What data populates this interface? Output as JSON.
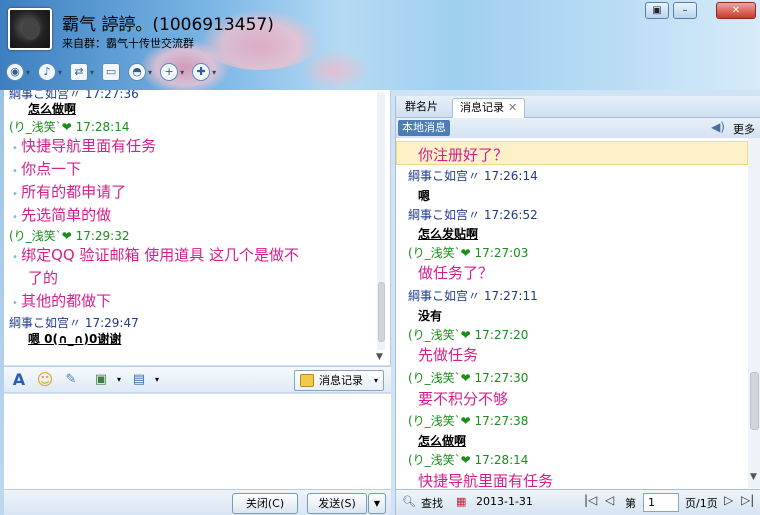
{
  "header": {
    "group_name": "霸气 諪諪。(1006913457)",
    "from_group": "来自群：霸气十传世交流群",
    "window_controls": [
      "▣",
      "–",
      "✕"
    ]
  },
  "toolbar": {
    "icons": [
      "video-icon",
      "voice-icon",
      "file-transfer-icon",
      "remote-icon",
      "share-icon",
      "add-member-icon",
      "app-icon"
    ]
  },
  "chat": {
    "messages": [
      {
        "kind": "sender-blue",
        "text": "綱事こ如宫〃   17:27:36"
      },
      {
        "kind": "bold-u",
        "text": "怎么做啊"
      },
      {
        "kind": "sender-green",
        "name": "(り_浅笑`",
        "time": "17:28:14"
      },
      {
        "kind": "pink",
        "text": "快捷导航里面有任务"
      },
      {
        "kind": "pink",
        "text": "你点一下"
      },
      {
        "kind": "pink",
        "text": "所有的都申请了"
      },
      {
        "kind": "pink",
        "text": "先选简单的做"
      },
      {
        "kind": "sender-green",
        "name": "(り_浅笑`",
        "time": "17:29:32"
      },
      {
        "kind": "pink",
        "text": "绑定QQ 验证邮箱  使用道具   这几个是做不"
      },
      {
        "kind": "pink-cont",
        "text": "了的"
      },
      {
        "kind": "pink",
        "text": "其他的都做下"
      },
      {
        "kind": "sender-blue",
        "text": "綱事こ如宫〃   17:29:47"
      },
      {
        "kind": "bold-u",
        "text": "嗯 0(∩_∩)0谢谢"
      }
    ]
  },
  "input_toolbar": {
    "font_icon": "A",
    "emoji_icon": "☺",
    "msg_record_label": "消息记录"
  },
  "bottom_buttons": {
    "close_label": "关闭(C)",
    "send_label": "发送(S)"
  },
  "right_panel": {
    "tabs": [
      "群名片",
      "消息记录"
    ],
    "local_msg": "本地消息",
    "more": "更多",
    "history": [
      {
        "kind": "pink",
        "text": "你注册好了？"
      },
      {
        "kind": "sender-blue",
        "text": "綱事こ如宫〃 17:26:14"
      },
      {
        "kind": "bold",
        "text": "嗯"
      },
      {
        "kind": "sender-blue",
        "text": "綱事こ如宫〃 17:26:52"
      },
      {
        "kind": "bold-u",
        "text": "怎么发贴啊"
      },
      {
        "kind": "sender-green",
        "text": "(り_浅笑`❤ 17:27:03"
      },
      {
        "kind": "pink",
        "text": "做任务了？"
      },
      {
        "kind": "sender-blue",
        "text": "綱事こ如宫〃 17:27:11"
      },
      {
        "kind": "bold",
        "text": "没有"
      },
      {
        "kind": "sender-green",
        "text": "(り_浅笑`❤ 17:27:20"
      },
      {
        "kind": "pink",
        "text": "先做任务"
      },
      {
        "kind": "sender-green",
        "text": "(り_浅笑`❤ 17:27:30"
      },
      {
        "kind": "pink",
        "text": "要不积分不够"
      },
      {
        "kind": "sender-green",
        "text": "(り_浅笑`❤ 17:27:38"
      },
      {
        "kind": "bold-u",
        "text": "怎么做啊"
      },
      {
        "kind": "sender-green",
        "text": "(り_浅笑`❤ 17:28:14"
      },
      {
        "kind": "pink",
        "text": "快捷导航里面有任务"
      }
    ],
    "bottom": {
      "search": "查找",
      "date": "2013-1-31",
      "page_prefix": "第",
      "page_value": "1",
      "page_suffix": "页/1页"
    }
  }
}
